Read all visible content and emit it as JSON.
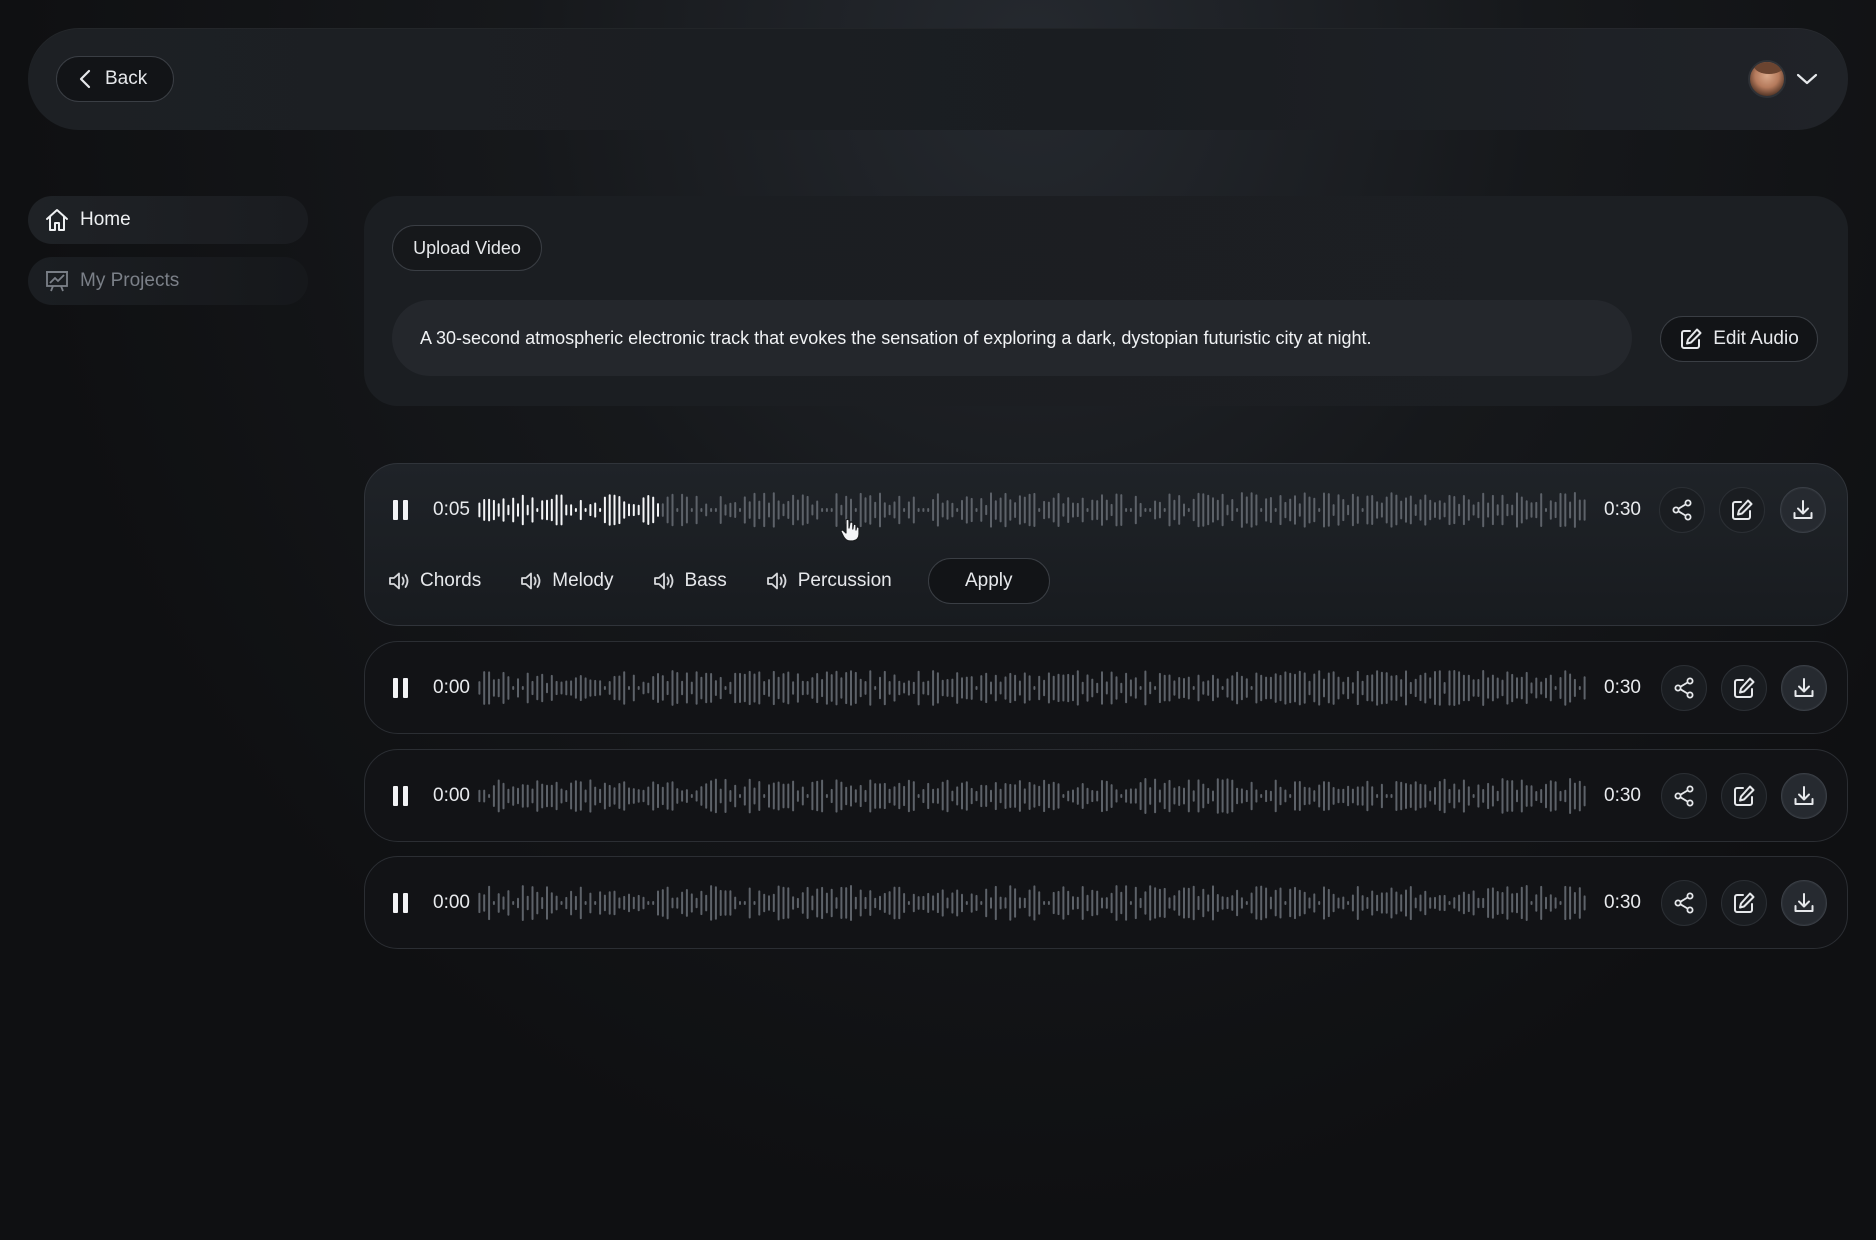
{
  "header": {
    "back_label": "Back",
    "user_menu": {
      "avatar": "user-avatar",
      "chevron": "chevron-down-icon"
    }
  },
  "sidebar": {
    "items": [
      {
        "label": "Home",
        "icon": "home-icon",
        "active": true
      },
      {
        "label": "My Projects",
        "icon": "chart-board-icon",
        "active": false
      }
    ]
  },
  "prompt": {
    "upload_label": "Upload Video",
    "text": "A 30-second atmospheric electronic track that evokes the sensation of exploring a dark, dystopian futuristic city at night.",
    "edit_audio_label": "Edit Audio"
  },
  "tracks": [
    {
      "current": "0:05",
      "duration": "0:30",
      "progress": 0.167,
      "expanded": true
    },
    {
      "current": "0:00",
      "duration": "0:30",
      "progress": 0,
      "expanded": false
    },
    {
      "current": "0:00",
      "duration": "0:30",
      "progress": 0,
      "expanded": false
    },
    {
      "current": "0:00",
      "duration": "0:30",
      "progress": 0,
      "expanded": false
    }
  ],
  "stems": {
    "items": [
      "Chords",
      "Melody",
      "Bass",
      "Percussion"
    ],
    "apply_label": "Apply"
  },
  "colors": {
    "wave_played": "#f4f5f7",
    "wave_unplayed": "#5d6269"
  }
}
